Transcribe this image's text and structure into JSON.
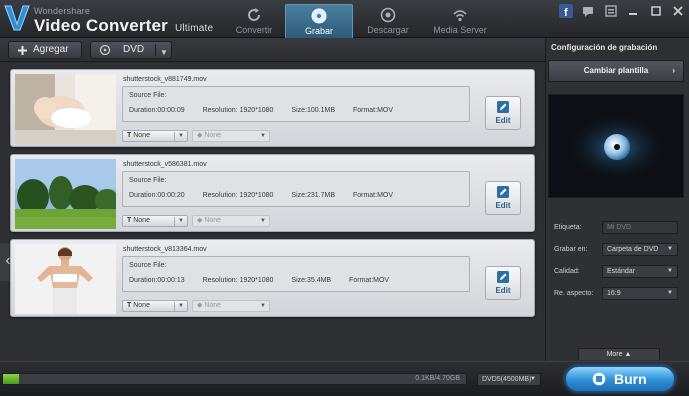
{
  "app": {
    "brand_small": "Wondershare",
    "brand_main": "Video Converter",
    "brand_edition": "Ultimate"
  },
  "tabs": [
    {
      "label": "Convertir",
      "icon": "refresh-icon",
      "active": false
    },
    {
      "label": "Grabar",
      "icon": "disc-icon",
      "active": true
    },
    {
      "label": "Descargar",
      "icon": "download-icon",
      "active": false
    },
    {
      "label": "Media Server",
      "icon": "wifi-icon",
      "active": false
    }
  ],
  "window_buttons": [
    "facebook-icon",
    "chat-icon",
    "settings-icon",
    "minimize-icon",
    "maximize-icon",
    "close-icon"
  ],
  "toolbar": {
    "add_label": "Agregar",
    "output_label": "DVD"
  },
  "items": [
    {
      "filename": "shutterstock_v881749.mov",
      "source_label": "Source File:",
      "duration": "Duration:00:00:09",
      "resolution": "Resolution: 1920*1080",
      "size": "Size:100.1MB",
      "format": "Format:MOV",
      "subtitle": "None",
      "audio": "None",
      "edit_label": "Edit",
      "thumb": "baby-photo"
    },
    {
      "filename": "shutterstock_v586381.mov",
      "source_label": "Source File:",
      "duration": "Duration:00:00:20",
      "resolution": "Resolution: 1920*1080",
      "size": "Size:231.7MB",
      "format": "Format:MOV",
      "subtitle": "None",
      "audio": "None",
      "edit_label": "Edit",
      "thumb": "field-photo"
    },
    {
      "filename": "shutterstock_v813364.mov",
      "source_label": "Source File:",
      "duration": "Duration:00:00:13",
      "resolution": "Resolution: 1920*1080",
      "size": "Size:35.4MB",
      "format": "Format:MOV",
      "subtitle": "None",
      "audio": "None",
      "edit_label": "Edit",
      "thumb": "woman-photo"
    }
  ],
  "panel": {
    "title": "Configuración de grabación",
    "template_button": "Cambiar plantilla",
    "fields": [
      {
        "label": "Etiqueta:",
        "value": "Mi DVD",
        "readonly": true
      },
      {
        "label": "Grabar en:",
        "value": "Carpeta de DVD",
        "readonly": false
      },
      {
        "label": "Calidad:",
        "value": "Estándar",
        "readonly": false
      },
      {
        "label": "Re. aspecto:",
        "value": "16:9",
        "readonly": false
      }
    ],
    "more_label": "More"
  },
  "bottom": {
    "progress_text": "0.1KB/4.70GB",
    "progress_fraction": 0.035,
    "disc_type": "DVD5(4500MB)",
    "burn_label": "Burn"
  },
  "colors": {
    "accent": "#2c8ed6",
    "progress": "#6fbf32",
    "edit_text": "#2d5f88"
  }
}
